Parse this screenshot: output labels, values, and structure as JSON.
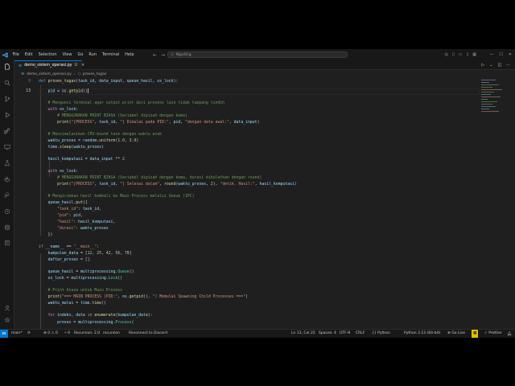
{
  "titlebar": {
    "menu": [
      "File",
      "Edit",
      "Selection",
      "View",
      "Go",
      "Run",
      "Terminal",
      "Help"
    ],
    "search": "Ngoding"
  },
  "tab": {
    "filename": "demo_sistem_operasi.py",
    "status": "U",
    "close": "×"
  },
  "breadcrumb": {
    "file": "demo_sistem_operasi.py",
    "symbol": "proses_tugas"
  },
  "editor": {
    "line_numbers": [
      "9",
      "",
      "13",
      "",
      "",
      "",
      "",
      "",
      "",
      "",
      "",
      "",
      "",
      "",
      "",
      "",
      "",
      "",
      "",
      "",
      "",
      "",
      "",
      "",
      "",
      "",
      "",
      "",
      "",
      "",
      "",
      "",
      "",
      "",
      "",
      "",
      "",
      "",
      "",
      "",
      "",
      "",
      "",
      "",
      "",
      "",
      "",
      "",
      "",
      "",
      "",
      "",
      "",
      "",
      "",
      "",
      "50"
    ],
    "lines": [
      {
        "text": "def proses_tugas(task_id, data_input, queue_hasil, os_lock):"
      },
      {
        "text": "pid = os.getpid()"
      },
      {
        "text": "# Mengunci terminal agar output print dari process lain tidak tumpang tindih"
      },
      {
        "text": "with os_lock:"
      },
      {
        "text": "# MENGGUNAKAN PRINT BIASA (Variabel dipisah dengan koma)"
      },
      {
        "text": "print(\"[PROCESS\", task_id, \"] Dimulai pada PID:\", pid, \"dengan data awal:\", data_input)"
      },
      {
        "text": "# Mensimulasikan CPU-bound task dengan waktu acak"
      },
      {
        "text": "waktu_proses = random.uniform(1.0, 3.0)"
      },
      {
        "text": "time.sleep(waktu_proses)"
      },
      {
        "text": "hasil_komputasi = data_input ** 2"
      },
      {
        "text": "with os_lock:"
      },
      {
        "text": "# MENGGUNAKAN PRINT BIASA (Variabel dipisah dengan koma, durasi dibulatkan dengan round)"
      },
      {
        "text": "print(\"[PROCESS\", task_id, \"] Selesai dalam\", round(waktu_proses, 2), \"detik. Hasil:\", hasil_komputasi)"
      },
      {
        "text": "# Mengirimkan hasil kembali ke Main Process melalui Queue (IPC)"
      },
      {
        "text": "queue_hasil.put({"
      },
      {
        "text": "\"task_id\": task_id,"
      },
      {
        "text": "\"pid\": pid,"
      },
      {
        "text": "\"hasil\": hasil_komputasi,"
      },
      {
        "text": "\"durasi\": waktu_proses"
      },
      {
        "text": "})"
      },
      {
        "text": "if __name__ == \"__main__\":"
      },
      {
        "text": "kumpulan_data = [12, 25, 42, 56, 78]"
      },
      {
        "text": "daftar_proses = []"
      },
      {
        "text": "queue_hasil = multiprocessing.Queue()"
      },
      {
        "text": "os_lock = multiprocessing.Lock()"
      },
      {
        "text": "# Print biasa untuk Main Process"
      },
      {
        "text": "print(\"=== MAIN PROCESS (PID:\", os.getpid(), \") Memulai Spawning Child Processes ===\")"
      },
      {
        "text": "waktu_mulai = time.time()"
      },
      {
        "text": "for indeks, data in enumerate(kumpulan_data):"
      },
      {
        "text": "proses = multiprocessing.Process("
      }
    ]
  },
  "statusbar": {
    "branch": "main*",
    "sync": "⟳",
    "problems": "⊗ 0 ⚠ 0",
    "ports": "⑂ 0",
    "recursion": "Recursion: 2.0",
    "recursion2": "recursion",
    "reconnect": "Reconnect to Discord",
    "position": "Ln 13, Col 22",
    "spaces": "Spaces: 4",
    "encoding": "UTF-8",
    "eol": "CRLF",
    "language": "{} Python",
    "interpreter": "Python 3.13 (64-bit)",
    "golive": "⊕ Go Live",
    "prettier": "✓ Prettier"
  },
  "colors": {
    "accent": "#0078d4",
    "bg": "#1f1f1f",
    "sidebar": "#181818"
  }
}
